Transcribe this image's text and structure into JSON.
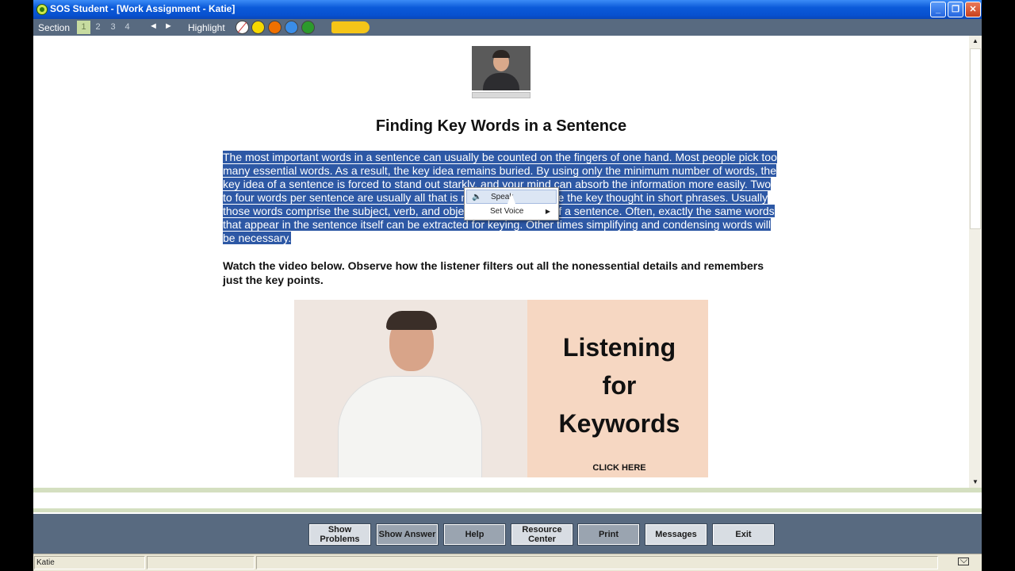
{
  "window": {
    "title": "SOS Student - [Work Assignment - Katie]"
  },
  "toolbar": {
    "section_label": "Section",
    "sections": [
      "1",
      "2",
      "3",
      "4"
    ],
    "active_section": "1",
    "prev_arrow": "◄",
    "next_arrow": "►",
    "highlight_label": "Highlight",
    "highlight_colors": [
      "#ffffff",
      "#f5d800",
      "#f07000",
      "#3a8de8",
      "#2c9a2c"
    ],
    "marker_color": "#f5c518"
  },
  "content": {
    "heading": "Finding Key Words in a Sentence",
    "paragraph": "The most important words in a sentence can usually be counted on the fingers of one hand. Most people pick too many essential words. As a result, the key idea remains buried. By using only the minimum number of words, the key idea of a sentence is forced to stand out starkly, and your mind can absorb the information more easily. Two to four words per sentence are usually all that is necessary to capture the key thought in short phrases. Usually those words comprise the subject, verb, and object or complement of a sentence. Often, exactly the same words that appear in the sentence itself can be extracted for keying. Other times simplifying and condensing words will be necessary.",
    "instruction": "Watch the video below. Observe how the listener filters out all the nonessential details and remembers just the key points.",
    "video_title_lines": [
      "Listening",
      "for",
      "Keywords"
    ],
    "video_cta": "CLICK HERE"
  },
  "context_menu": {
    "items": [
      {
        "label": "Speak",
        "icon": "speaker-icon"
      },
      {
        "label": "Set Voice",
        "icon": "submenu-arrow-icon"
      }
    ]
  },
  "buttons": {
    "show_problems": "Show Problems",
    "show_answer": "Show Answer",
    "help": "Help",
    "resource_center": "Resource Center",
    "print": "Print",
    "messages": "Messages",
    "exit": "Exit"
  },
  "status": {
    "user": "Katie"
  },
  "colors": {
    "selection": "#2d58a5",
    "toolbar_bg": "#586a80"
  }
}
